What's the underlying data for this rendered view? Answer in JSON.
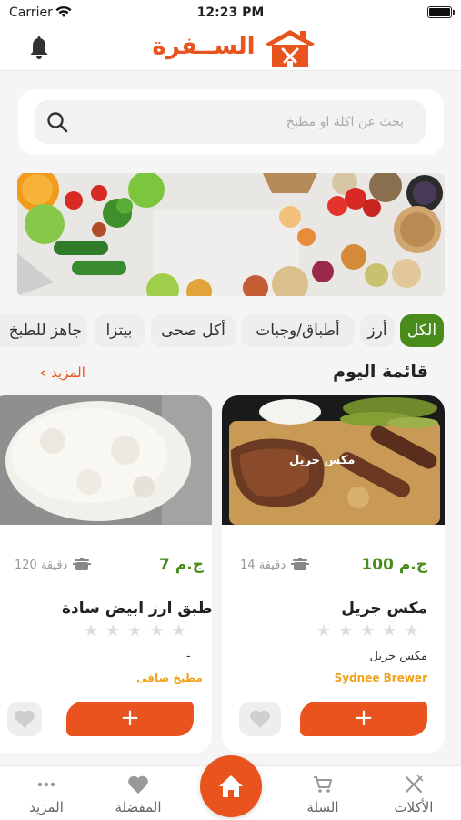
{
  "status_bar": {
    "carrier": "Carrier",
    "time": "12:23 PM"
  },
  "header": {
    "logo_text": "الســفرة",
    "brand_color": "#e8531e"
  },
  "search": {
    "placeholder": "بحث عن اكلة او مطبخ"
  },
  "categories": [
    {
      "label": "الكل",
      "active": true
    },
    {
      "label": "أرز",
      "active": false
    },
    {
      "label": "أطباق/وجبات",
      "active": false
    },
    {
      "label": "أكل صحى",
      "active": false
    },
    {
      "label": "بيتزا",
      "active": false
    },
    {
      "label": "جاهز للطبخ",
      "active": false
    }
  ],
  "section": {
    "title": "قائمة اليوم",
    "more_label": "المزيد"
  },
  "cards": [
    {
      "price": "100 ج.م",
      "time": "14 دقيقة",
      "title": "مكس جريل",
      "image_overlay": "مكس جريل",
      "subtitle": "مكس جريل",
      "chef": "Sydnee Brewer",
      "rating": 0,
      "add_label": "+"
    },
    {
      "price": "7 ج.م",
      "time": "120 دقيقة",
      "title": "طبق ارز ابيض سادة",
      "subtitle": "-",
      "chef": "مطبخ صافى",
      "rating": 0,
      "add_label": "+"
    }
  ],
  "tabbar": {
    "items": [
      {
        "label": "الأكلات",
        "icon": "utensils-icon"
      },
      {
        "label": "السلة",
        "icon": "cart-icon"
      },
      {
        "label": "المفضلة",
        "icon": "heart-icon"
      },
      {
        "label": "المزيد",
        "icon": "more-dots-icon"
      }
    ],
    "home_icon": "home-icon"
  },
  "colors": {
    "accent": "#e8531e",
    "green": "#4a8c1c",
    "chef": "#f1a21a"
  }
}
